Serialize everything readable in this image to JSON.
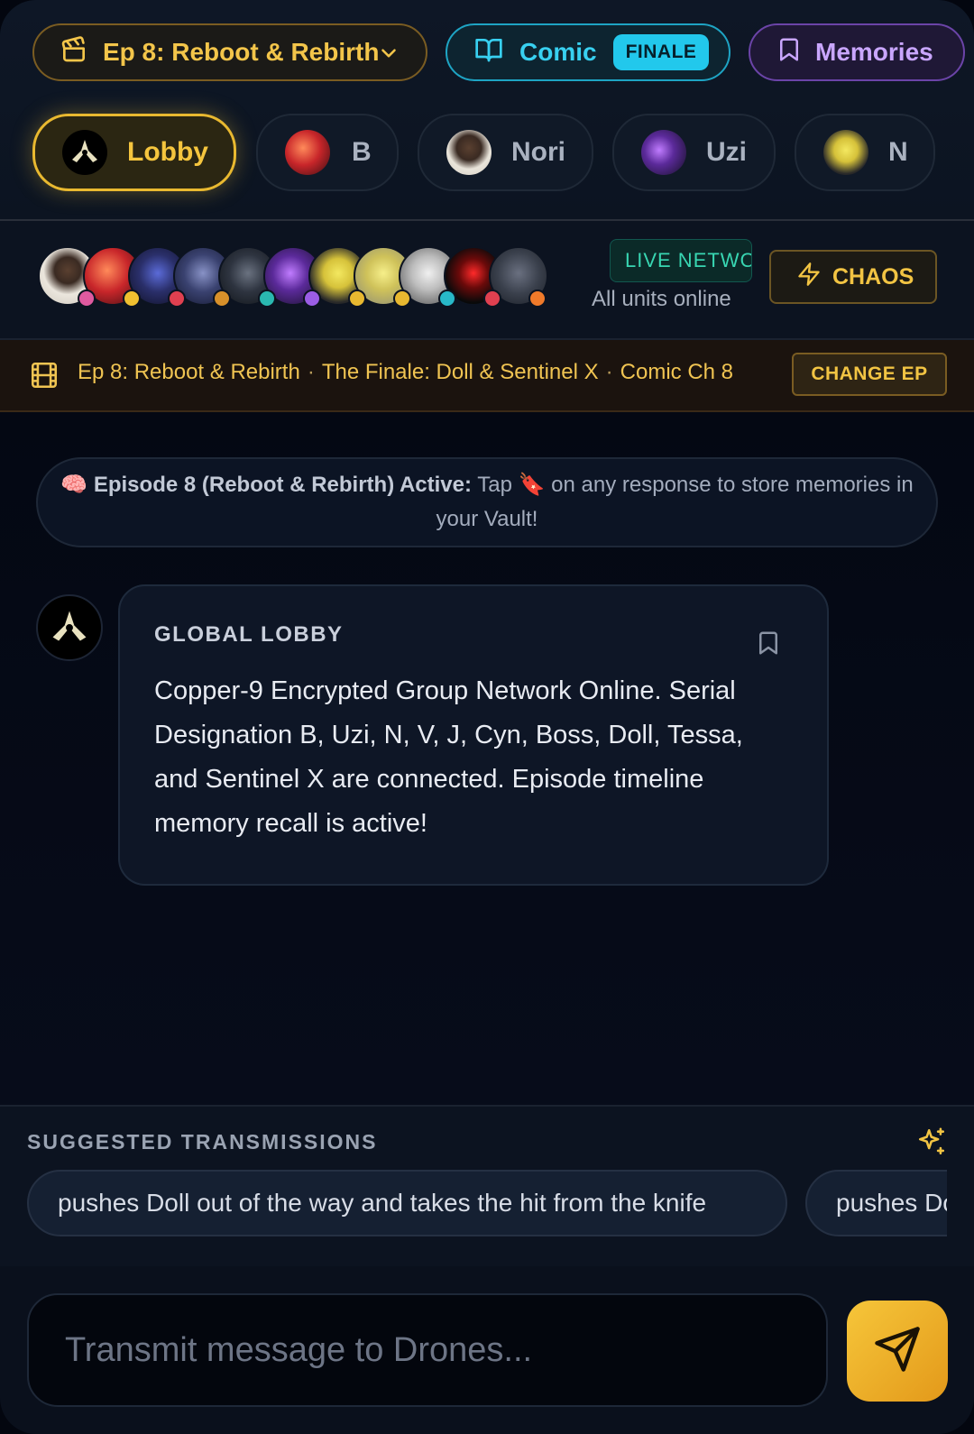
{
  "header": {
    "episode_select": "Ep 8: Reboot & Rebirth",
    "comic_label": "Comic",
    "comic_badge": "FINALE",
    "memories_label": "Memories",
    "characters": [
      {
        "name": "Lobby",
        "active": true
      },
      {
        "name": "B",
        "active": false
      },
      {
        "name": "Nori",
        "active": false
      },
      {
        "name": "Uzi",
        "active": false
      },
      {
        "name": "N",
        "active": false
      }
    ]
  },
  "network": {
    "live_label": "LIVE NETWORK",
    "status_text": "All units online",
    "chaos_label": "CHAOS",
    "status_dot_colors": [
      "#e05aa0",
      "#f0c030",
      "#e04050",
      "#d8902a",
      "#2ab8b0",
      "#9b5de5",
      "#e8b830",
      "#e8b830",
      "#28b8c8",
      "#e04050",
      "#f07a2a"
    ]
  },
  "episode_bar": {
    "episode": "Ep 8: Reboot & Rebirth",
    "arc": "The Finale: Doll & Sentinel X",
    "comic": "Comic Ch 8",
    "change_label": "CHANGE EP"
  },
  "chat": {
    "notice_strong": "🧠 Episode 8 (Reboot & Rebirth) Active:",
    "notice_rest_1": "Tap",
    "notice_emoji": "🔖",
    "notice_rest_2": "on any response to store memories in your Vault!",
    "messages": [
      {
        "sender": "GLOBAL LOBBY",
        "text": "Copper-9 Encrypted Group Network Online. Serial Designation B, Uzi, N, V, J, Cyn, Boss, Doll, Tessa, and Sentinel X are connected. Episode timeline memory recall is active!"
      }
    ]
  },
  "suggestions": {
    "title": "SUGGESTED TRANSMISSIONS",
    "items": [
      "pushes Doll out of the way and takes the hit from the knife",
      "pushes Doll"
    ]
  },
  "composer": {
    "placeholder": "Transmit message to Drones..."
  },
  "colors": {
    "accent_gold": "#f2c443",
    "accent_cyan": "#22c8ec",
    "accent_purple": "#c9a6ff",
    "live_green": "#38d6b2"
  }
}
